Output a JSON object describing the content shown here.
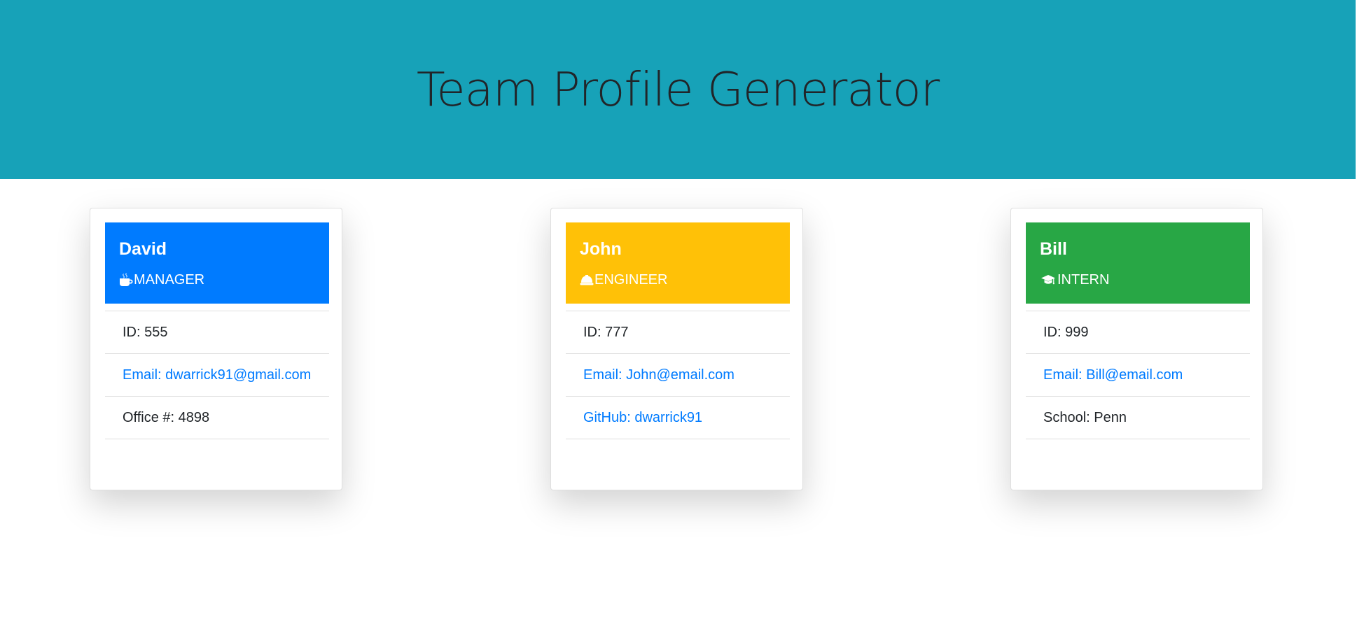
{
  "header": {
    "title": "Team Profile Generator",
    "background": "#17a2b8"
  },
  "cards": [
    {
      "name": "David",
      "role": "MANAGER",
      "icon": "mug-icon",
      "color": "#007bff",
      "items": [
        {
          "text": "ID: 555"
        },
        {
          "text": "Email: dwarrick91@gmail.com"
        },
        {
          "text": "Office #: 4898"
        }
      ]
    },
    {
      "name": "John",
      "role": "ENGINEER",
      "icon": "hard-hat-icon",
      "color": "#ffc107",
      "items": [
        {
          "text": "ID: 777"
        },
        {
          "text": "Email: John@email.com"
        },
        {
          "text": "GitHub: dwarrick91"
        }
      ]
    },
    {
      "name": "Bill",
      "role": "INTERN",
      "icon": "graduation-cap-icon",
      "color": "#28a745",
      "items": [
        {
          "text": "ID: 999"
        },
        {
          "text": "Email: Bill@email.com"
        },
        {
          "text": "School: Penn"
        }
      ]
    }
  ],
  "link_color": "#007bff"
}
